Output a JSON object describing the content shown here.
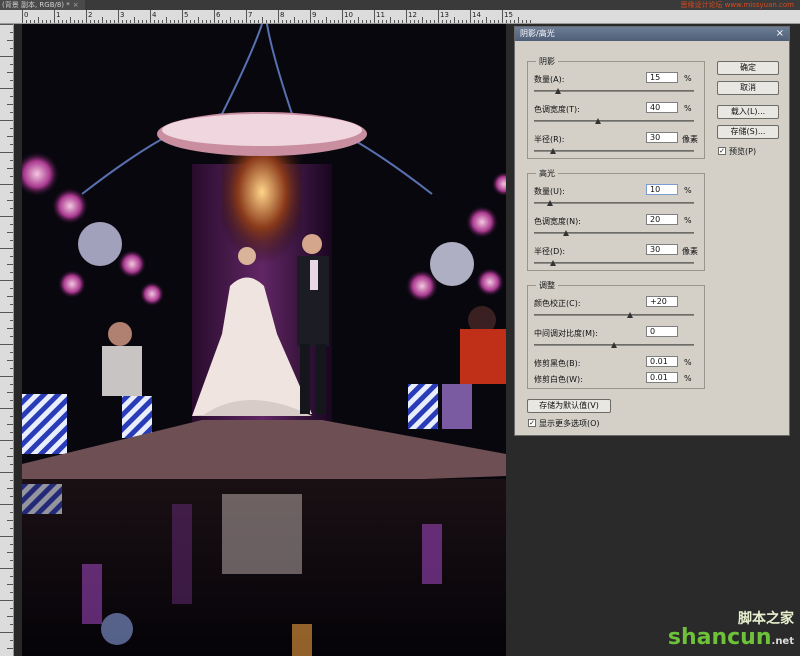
{
  "document_tab": {
    "title": "(背景 副本, RGB/8) *",
    "close": "×"
  },
  "top_watermark": "思缘设计论坛 www.missyuan.com",
  "ruler": {
    "labels": [
      "0",
      "1",
      "2",
      "3",
      "4",
      "5",
      "6",
      "7",
      "8",
      "9",
      "10",
      "11",
      "12",
      "13",
      "14",
      "15"
    ]
  },
  "dialog": {
    "title": "阴影/高光",
    "close": "×",
    "shadows": {
      "group_title": "阴影",
      "amount": {
        "label": "数量(A):",
        "value": "15",
        "unit": "%",
        "level": 0.15
      },
      "tonal_width": {
        "label": "色调宽度(T):",
        "value": "40",
        "unit": "%",
        "level": 0.4
      },
      "radius": {
        "label": "半径(R):",
        "value": "30",
        "unit": "像素",
        "level": 0.12
      }
    },
    "highlights": {
      "group_title": "高光",
      "amount": {
        "label": "数量(U):",
        "value": "10",
        "unit": "%",
        "level": 0.1
      },
      "tonal_width": {
        "label": "色调宽度(N):",
        "value": "20",
        "unit": "%",
        "level": 0.2
      },
      "radius": {
        "label": "半径(D):",
        "value": "30",
        "unit": "像素",
        "level": 0.12
      }
    },
    "adjustments": {
      "group_title": "调整",
      "color_correction": {
        "label": "颜色校正(C):",
        "value": "+20",
        "level": 0.6
      },
      "midtone_contrast": {
        "label": "中间调对比度(M):",
        "value": "0",
        "level": 0.5
      },
      "black_clip": {
        "label": "修剪黑色(B):",
        "value": "0.01",
        "unit": "%"
      },
      "white_clip": {
        "label": "修剪白色(W):",
        "value": "0.01",
        "unit": "%"
      }
    },
    "buttons": {
      "ok": "确定",
      "cancel": "取消",
      "load": "载入(L)...",
      "save": "存储(S)...",
      "save_default": "存储为默认值(V)"
    },
    "preview": {
      "label": "预览(P)",
      "checked": true
    },
    "show_more": {
      "label": "显示更多选项(O)",
      "checked": true
    }
  },
  "brand": {
    "cn": "脚本之家",
    "en": "shancun",
    "suffix": ".net"
  }
}
